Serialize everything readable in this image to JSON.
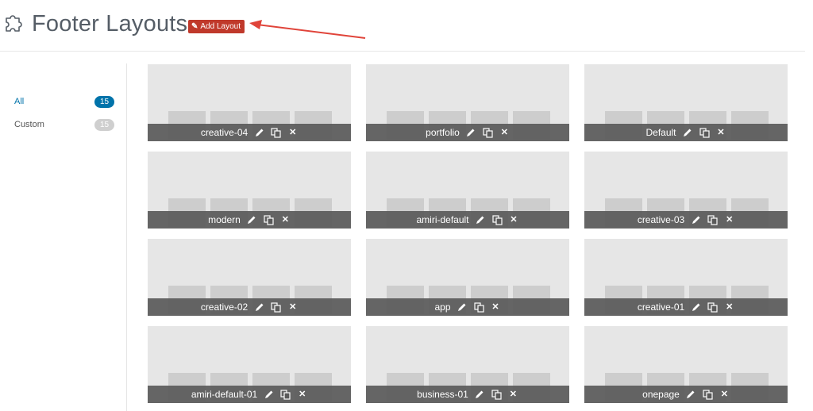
{
  "header": {
    "title": "Footer Layouts",
    "add_button_label": "Add Layout",
    "title_icon": "puzzle-icon"
  },
  "sidebar": {
    "filters": [
      {
        "label": "All",
        "count": "15",
        "active": true
      },
      {
        "label": "Custom",
        "count": "15",
        "active": false
      }
    ]
  },
  "layouts": [
    {
      "name": "creative-04"
    },
    {
      "name": "portfolio"
    },
    {
      "name": "Default"
    },
    {
      "name": "modern"
    },
    {
      "name": "amiri-default"
    },
    {
      "name": "creative-03"
    },
    {
      "name": "creative-02"
    },
    {
      "name": "app"
    },
    {
      "name": "creative-01"
    },
    {
      "name": "amiri-default-01"
    },
    {
      "name": "business-01"
    },
    {
      "name": "onepage"
    }
  ],
  "card_actions": [
    "edit-icon",
    "duplicate-icon",
    "delete-icon"
  ],
  "colors": {
    "accent": "#0073aa",
    "add_button": "#c0392b",
    "annotation_arrow": "#e0443a",
    "card_bg": "#e6e6e6",
    "card_bar": "#5a5a5a"
  }
}
